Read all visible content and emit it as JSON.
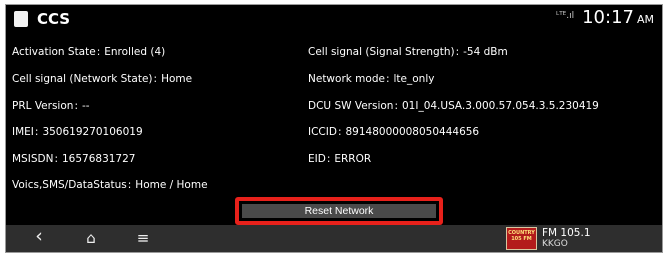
{
  "app": {
    "title": "CCS"
  },
  "status": {
    "signal_icon": "signal-lte-icon",
    "signal_text": "ᴸᵀᴱ.ıl",
    "time": "10:17",
    "ampm": "AM"
  },
  "info": {
    "left": [
      {
        "label": "Activation State",
        "value": "Enrolled (4)"
      },
      {
        "label": "Cell signal (Network State)",
        "value": "Home"
      },
      {
        "label": "PRL Version",
        "value": "--"
      },
      {
        "label": "IMEI",
        "value": "350619270106019"
      },
      {
        "label": "MSISDN",
        "value": "16576831727"
      },
      {
        "label": "Voics,SMS/DataStatus",
        "value": "Home / Home"
      }
    ],
    "right": [
      {
        "label": "Cell signal (Signal Strength)",
        "value": "-54 dBm"
      },
      {
        "label": "Network mode",
        "value": "lte_only"
      },
      {
        "label": "DCU SW Version",
        "value": "01I_04.USA.3.000.57.054.3.5.230419"
      },
      {
        "label": "ICCID",
        "value": "89148000008050444656"
      },
      {
        "label": "EID",
        "value": "ERROR"
      }
    ],
    "separator": ":"
  },
  "reset_button": {
    "label": "Reset Network",
    "highlight_color": "#e8211b"
  },
  "bottom_nav": {
    "back_icon": "back-icon",
    "back_glyph": "‹",
    "home_icon": "home-icon",
    "home_glyph": "⌂",
    "menu_icon": "menu-icon",
    "menu_glyph": "≡"
  },
  "radio": {
    "logo_text": "COUNTRY 105 FM",
    "frequency": "FM 105.1",
    "station": "KKGO"
  }
}
